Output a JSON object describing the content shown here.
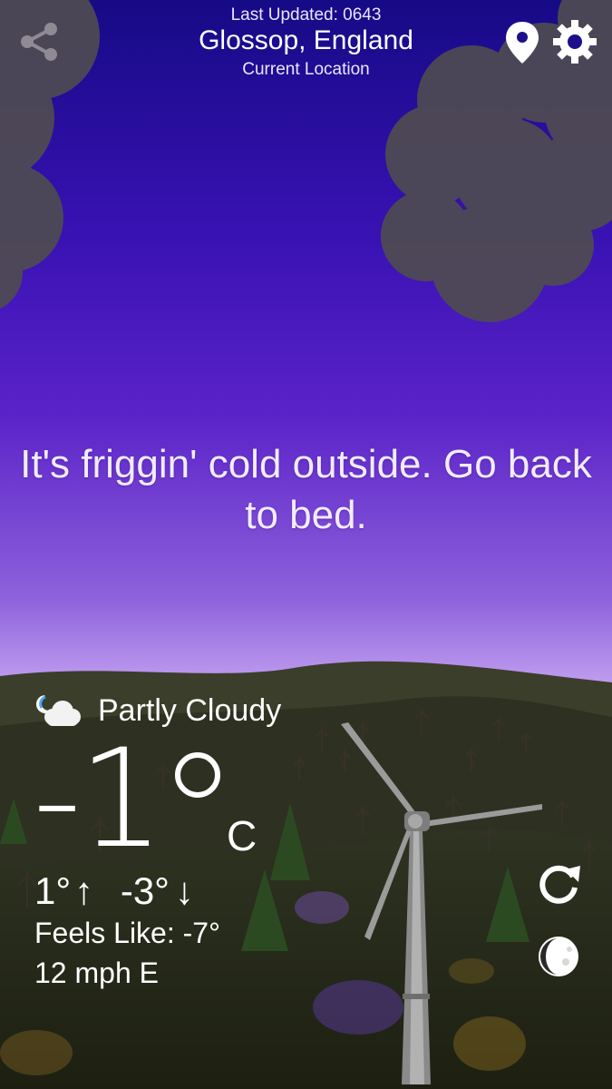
{
  "header": {
    "last_updated": "Last Updated: 0643",
    "location": "Glossop, England",
    "sublabel": "Current Location"
  },
  "icons": {
    "share": "share-icon",
    "location": "location-pin-icon",
    "settings": "gear-icon",
    "condition": "partly-cloudy-night-icon",
    "refresh": "refresh-icon",
    "moon": "moon-phase-icon"
  },
  "message": "It's friggin' cold outside. Go back to bed.",
  "weather": {
    "condition": "Partly Cloudy",
    "temperature": "-1",
    "unit": "C",
    "high": "1°",
    "high_arrow": "↑",
    "low": "-3°",
    "low_arrow": "↓",
    "feels_like": "Feels Like: -7°",
    "wind": "12 mph E"
  },
  "colors": {
    "sky_top": "#160a86",
    "sky_mid": "#5a22c8",
    "sky_horizon": "#c7a6f2",
    "clouds": "#4e4a54",
    "hills": "#2e3121",
    "foreground": "#1e2212",
    "text": "#ffffff"
  }
}
